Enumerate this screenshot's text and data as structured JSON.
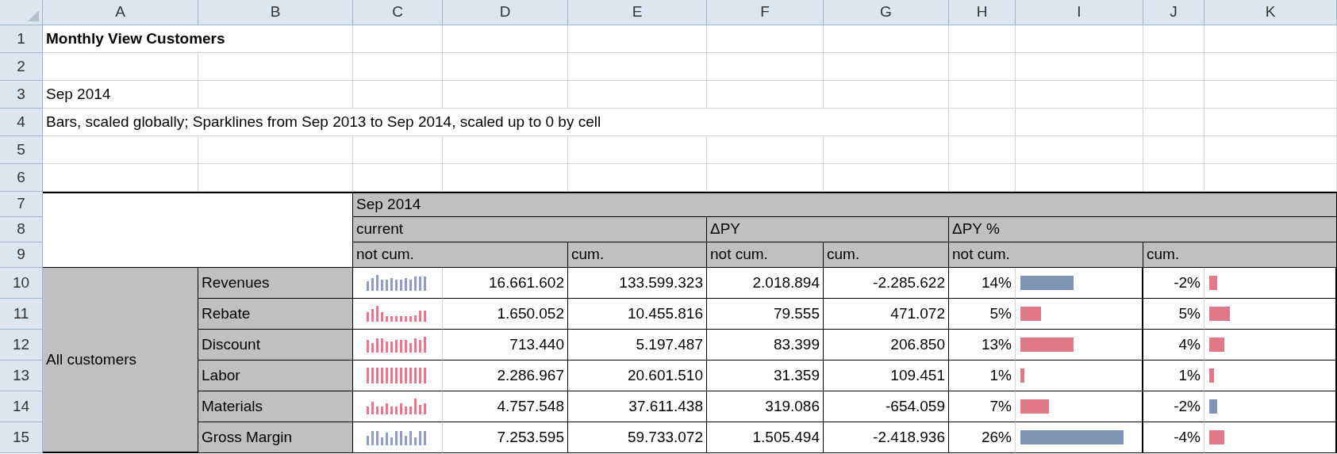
{
  "column_headers": [
    "A",
    "B",
    "C",
    "D",
    "E",
    "F",
    "G",
    "H",
    "I",
    "J",
    "K"
  ],
  "row_headers": [
    "1",
    "2",
    "3",
    "4",
    "5",
    "6",
    "7",
    "8",
    "9",
    "10",
    "11",
    "12",
    "13",
    "14",
    "15"
  ],
  "title": "Monthly View Customers",
  "date": "Sep 2014",
  "note": "Bars, scaled globally; Sparklines from Sep 2013 to Sep 2014, scaled up to 0 by cell",
  "table": {
    "period": "Sep 2014",
    "groups": [
      "current",
      "ΔPY",
      "ΔPY %"
    ],
    "subheaders": [
      "not cum.",
      "cum.",
      "not cum.",
      "cum.",
      "not cum.",
      "cum."
    ],
    "row_group": "All customers",
    "rows": [
      {
        "label": "Revenues",
        "sparkline": {
          "color": "#8d9dc6"
        },
        "current": "16.661.602",
        "current_cum": "133.599.323",
        "dpy": "2.018.894",
        "dpy_cum": "-2.285.622",
        "pct": {
          "value": "14%",
          "level": 0.43,
          "color": "#7f93b5"
        },
        "pct_cum": {
          "value": "-2%",
          "level": 0.06,
          "color": "#e07a88"
        }
      },
      {
        "label": "Rebate",
        "sparkline": {
          "color": "#e8768f"
        },
        "current": "1.650.052",
        "current_cum": "10.455.816",
        "dpy": "79.555",
        "dpy_cum": "471.072",
        "pct": {
          "value": "5%",
          "level": 0.17,
          "color": "#e07a88"
        },
        "pct_cum": {
          "value": "5%",
          "level": 0.16,
          "color": "#e07a88"
        }
      },
      {
        "label": "Discount",
        "sparkline": {
          "color": "#e8768f"
        },
        "current": "713.440",
        "current_cum": "5.197.487",
        "dpy": "83.399",
        "dpy_cum": "206.850",
        "pct": {
          "value": "13%",
          "level": 0.43,
          "color": "#e07a88"
        },
        "pct_cum": {
          "value": "4%",
          "level": 0.12,
          "color": "#e07a88"
        }
      },
      {
        "label": "Labor",
        "sparkline": {
          "color": "#e8768f"
        },
        "current": "2.286.967",
        "current_cum": "20.601.510",
        "dpy": "31.359",
        "dpy_cum": "109.451",
        "pct": {
          "value": "1%",
          "level": 0.03,
          "color": "#e07a88"
        },
        "pct_cum": {
          "value": "1%",
          "level": 0.04,
          "color": "#e07a88"
        }
      },
      {
        "label": "Materials",
        "sparkline": {
          "color": "#e8768f"
        },
        "current": "4.757.548",
        "current_cum": "37.611.438",
        "dpy": "319.086",
        "dpy_cum": "-654.059",
        "pct": {
          "value": "7%",
          "level": 0.23,
          "color": "#e07a88"
        },
        "pct_cum": {
          "value": "-2%",
          "level": 0.06,
          "color": "#7f93b5"
        }
      },
      {
        "label": "Gross Margin",
        "sparkline": {
          "color": "#8d9dc6"
        },
        "current": "7.253.595",
        "current_cum": "59.733.072",
        "dpy": "1.505.494",
        "dpy_cum": "-2.418.936",
        "pct": {
          "value": "26%",
          "level": 0.84,
          "color": "#7f93b5"
        },
        "pct_cum": {
          "value": "-4%",
          "level": 0.12,
          "color": "#e07a88"
        }
      }
    ]
  }
}
